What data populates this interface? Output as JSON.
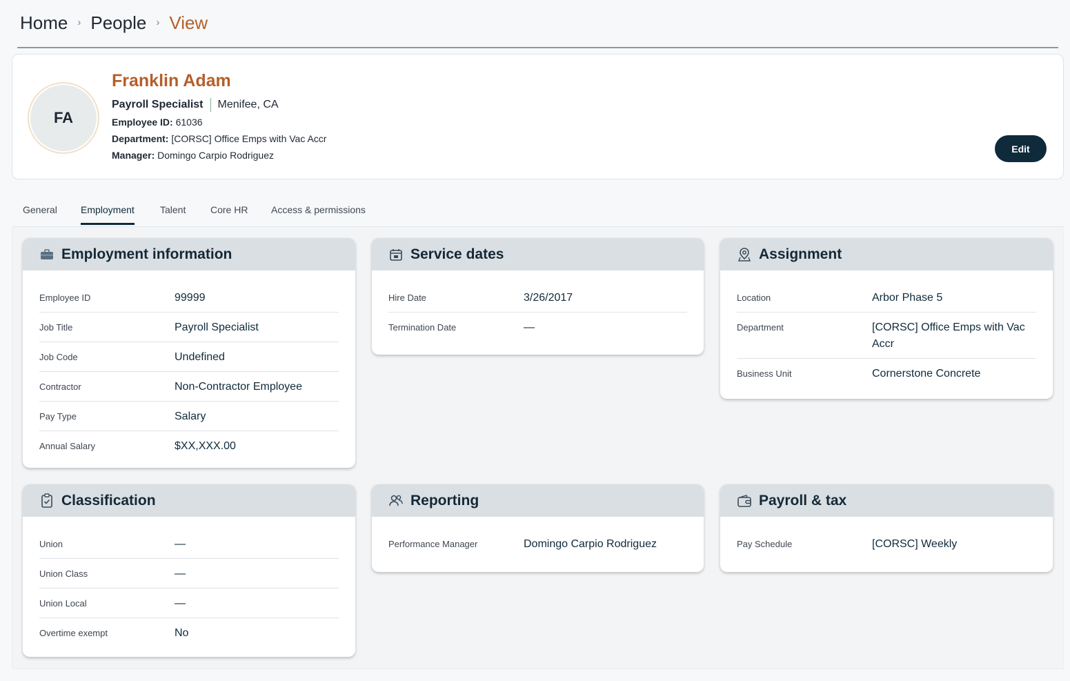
{
  "breadcrumb": {
    "home": "Home",
    "people": "People",
    "current": "View",
    "sep": "›"
  },
  "profile": {
    "initials": "FA",
    "name": "Franklin Adam",
    "job_title": "Payroll Specialist",
    "location": "Menifee, CA",
    "employee_id_label": "Employee ID:",
    "employee_id": "61036",
    "department_label": "Department:",
    "department": "[CORSC] Office Emps with Vac Accr",
    "manager_label": "Manager:",
    "manager": "Domingo Carpio Rodriguez",
    "edit_label": "Edit"
  },
  "tabs": [
    "General",
    "Employment",
    "Talent",
    "Core HR",
    "Access & permissions"
  ],
  "active_tab": "Employment",
  "cards": {
    "employment": {
      "title": "Employment information",
      "rows": [
        {
          "label": "Employee ID",
          "value": "99999"
        },
        {
          "label": "Job Title",
          "value": "Payroll Specialist"
        },
        {
          "label": "Job Code",
          "value": "Undefined"
        },
        {
          "label": "Contractor",
          "value": "Non-Contractor Employee"
        },
        {
          "label": "Pay Type",
          "value": "Salary"
        },
        {
          "label": "Annual Salary",
          "value": "$XX,XXX.00"
        }
      ]
    },
    "service": {
      "title": "Service dates",
      "rows": [
        {
          "label": "Hire Date",
          "value": "3/26/2017"
        },
        {
          "label": "Termination Date",
          "value": "—"
        }
      ]
    },
    "assignment": {
      "title": "Assignment",
      "rows": [
        {
          "label": "Location",
          "value": "Arbor Phase 5"
        },
        {
          "label": "Department",
          "value": "[CORSC] Office Emps with Vac Accr"
        },
        {
          "label": "Business Unit",
          "value": "Cornerstone Concrete"
        }
      ]
    },
    "classification": {
      "title": "Classification",
      "rows": [
        {
          "label": "Union",
          "value": "—"
        },
        {
          "label": "Union Class",
          "value": "—"
        },
        {
          "label": "Union Local",
          "value": "—"
        },
        {
          "label": "Overtime exempt",
          "value": "No"
        }
      ]
    },
    "reporting": {
      "title": "Reporting",
      "rows": [
        {
          "label": "Performance Manager",
          "value": "Domingo Carpio Rodriguez"
        }
      ]
    },
    "payroll": {
      "title": "Payroll & tax",
      "rows": [
        {
          "label": "Pay Schedule",
          "value": "[CORSC] Weekly"
        }
      ]
    }
  },
  "colors": {
    "accent": "#b45f2b",
    "primary": "#0f2a3a",
    "card_header": "#dadfe3"
  }
}
